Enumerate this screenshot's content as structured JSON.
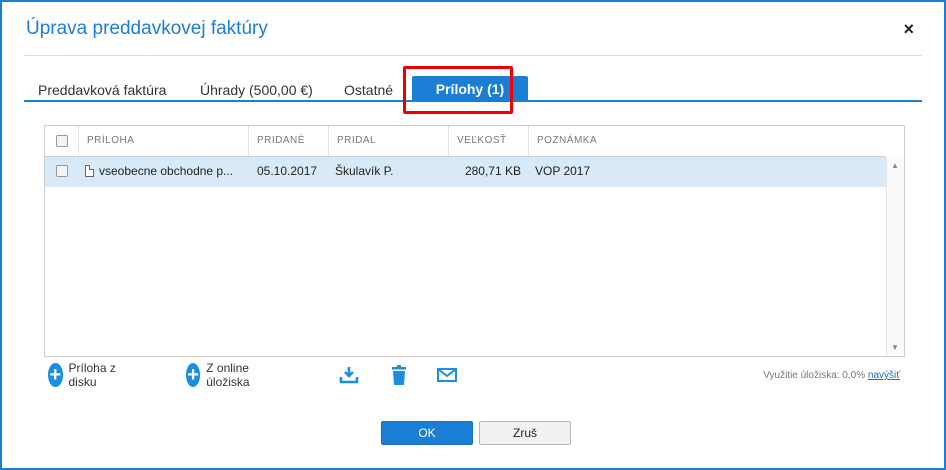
{
  "dialog": {
    "title": "Úprava preddavkovej faktúry",
    "close_label": "×"
  },
  "tabs": [
    {
      "label": "Preddavková faktúra"
    },
    {
      "label": "Úhrady (500,00 €)"
    },
    {
      "label": "Ostatné"
    },
    {
      "label": "Prílohy (1)",
      "active": true
    }
  ],
  "grid": {
    "columns": [
      "PRÍLOHA",
      "PRIDANÉ",
      "PRIDAL",
      "VEĽKOSŤ",
      "POZNÁMKA"
    ],
    "rows": [
      {
        "file": "vseobecne obchodne p...",
        "added": "05.10.2017",
        "author": "Škulavík P.",
        "size": "280,71 KB",
        "note": "VOP 2017",
        "selected": true
      }
    ]
  },
  "toolbar": {
    "add_disk": "Príloha z disku",
    "add_online": "Z online úložiska",
    "download_icon": "download-icon",
    "delete_icon": "trash-icon",
    "email_icon": "envelope-icon"
  },
  "usage": {
    "text": "Využitie úložiska: 0,0%",
    "link": "navýšiť"
  },
  "buttons": {
    "ok": "OK",
    "cancel": "Zruš"
  },
  "colors": {
    "accent": "#1a7fd4",
    "highlight": "#e00000",
    "row_selected": "#d8e9f8"
  }
}
